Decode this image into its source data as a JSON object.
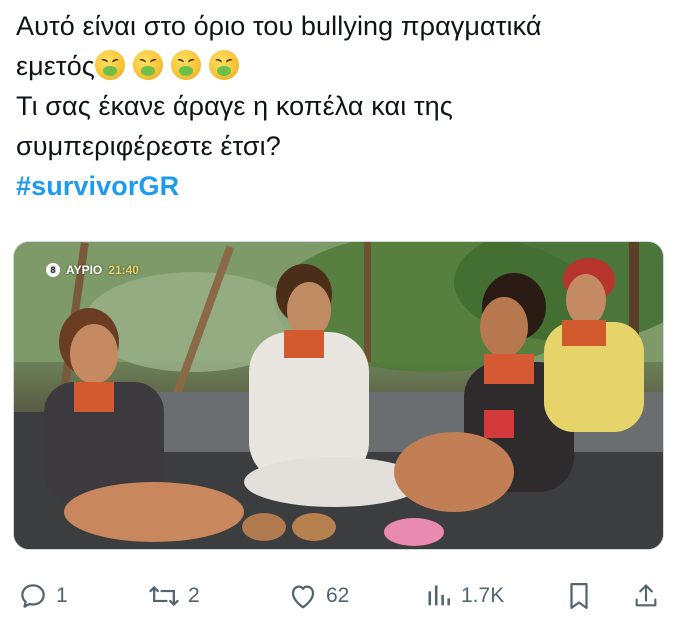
{
  "tweet": {
    "line1": "Αυτό είναι στο όριο του bullying πραγματικά",
    "line2_text": "εμετός",
    "line2_emojis": [
      "vomiting-face",
      "vomiting-face",
      "vomiting-face",
      "vomiting-face"
    ],
    "line3": "Τι σας έκανε άραγε η κοπέλα και της",
    "line4": "συμπεριφέρεστε έτσι?",
    "hashtag": "#survivorGR"
  },
  "media": {
    "channel_logo": "8",
    "badge_day": "ΑΥΡΙΟ",
    "badge_time": "21:40"
  },
  "actions": {
    "replies": "1",
    "reposts": "2",
    "likes": "62",
    "views": "1.7K"
  },
  "colors": {
    "text": "#0f1419",
    "muted": "#536471",
    "accent": "#1d9bf0"
  }
}
